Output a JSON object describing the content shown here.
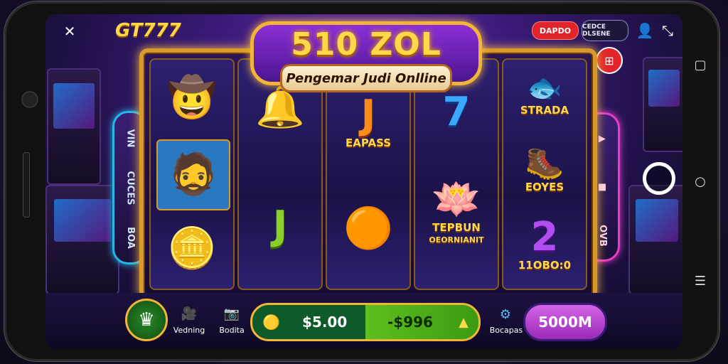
{
  "app": {
    "logo": "GT777"
  },
  "header": {
    "back_icon": "back-chevron-icon",
    "title": "510 ZOL",
    "subtitle": "Pengemar Judi Onlline",
    "btn_red": "DAPDO",
    "btn_dark": "CEDCE DLSENE",
    "profile_icon": "person-icon",
    "fullscreen_icon": "expand-arrows-icon"
  },
  "left_rail": {
    "items": [
      "VIN",
      "CUCES",
      "BOA"
    ]
  },
  "right_rail": {
    "items": [
      "▲",
      "■",
      "OVB"
    ]
  },
  "reels": [
    {
      "symbols": [
        {
          "icon": "cowboy-hat-man-icon",
          "glyph": "🤠",
          "label": ""
        },
        {
          "icon": "bearded-man-icon",
          "glyph": "🧔",
          "label": ""
        },
        {
          "icon": "gold-coin-icon",
          "glyph": "🪙",
          "label": ""
        }
      ]
    },
    {
      "symbols": [
        {
          "icon": "green-bell-icon",
          "glyph": "🔔",
          "label": ""
        },
        {
          "icon": "letter-j-green-icon",
          "glyph": "J",
          "label": ""
        }
      ]
    },
    {
      "symbols": [
        {
          "icon": "letter-j-orange-icon",
          "glyph": "J",
          "label": "EAPASS"
        },
        {
          "icon": "gold-orb-icon",
          "glyph": "🟠",
          "label": ""
        }
      ]
    },
    {
      "symbols": [
        {
          "icon": "number-seven-icon",
          "glyph": "7",
          "label": ""
        },
        {
          "icon": "lotus-flower-icon",
          "glyph": "🪷",
          "label": "TEPBUN"
        },
        {
          "icon": "",
          "glyph": "",
          "label": "OEORNIANIT"
        }
      ]
    },
    {
      "symbols": [
        {
          "icon": "feathered-fish-icon",
          "glyph": "🐟",
          "label": "STRADA"
        },
        {
          "icon": "silver-boot-icon",
          "glyph": "🥾",
          "label": "EOYES"
        },
        {
          "icon": "number-two-icon",
          "glyph": "2",
          "label": "11OBO:0"
        }
      ]
    }
  ],
  "bottom": {
    "home_label": "",
    "vedning_label": "Vedning",
    "bodita_label": "Bodita",
    "bet_value": "$5.00",
    "win_value": "-$996",
    "bocapas_label": "Bocapas",
    "spin_label": "5000M"
  },
  "colors": {
    "accent_gold": "#f2b53a",
    "spin_purple": "#c14bd6",
    "bet_green": "#2f9e2f",
    "red": "#e0242a"
  },
  "system_nav": {
    "square_icon": "square-icon",
    "circle_icon": "circle-icon",
    "menu_icon": "menu-icon"
  },
  "spin_ring": {
    "icon": "ring-icon"
  }
}
